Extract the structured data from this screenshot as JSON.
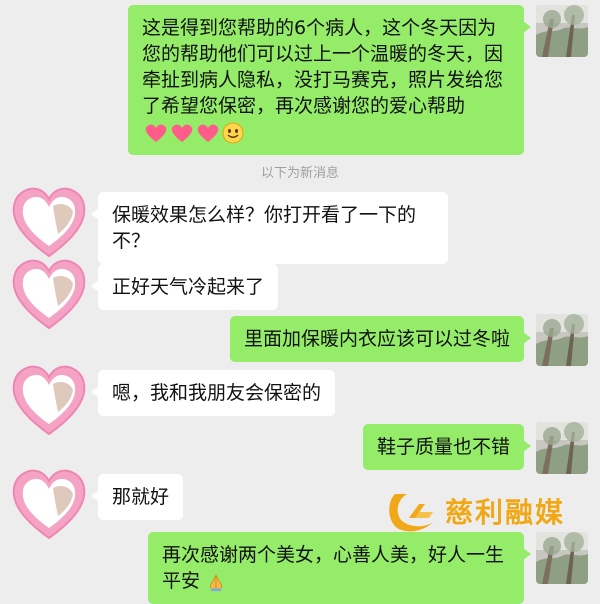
{
  "divider_text": "以下为新消息",
  "messages": [
    {
      "side": "right",
      "text": "这是得到您帮助的6个病人，这个冬天因为您的帮助他们可以过上一个温暖的冬天，因牵扯到病人隐私，没打马赛克，照片发给您了希望您保密，再次感谢您的爱心帮助",
      "emoji": [
        "heart-emoji",
        "heart-emoji",
        "heart-emoji",
        "smile-emoji"
      ]
    },
    {
      "side": "left",
      "text": "保暖效果怎么样？你打开看了一下的不？"
    },
    {
      "side": "left",
      "text": "正好天气冷起来了"
    },
    {
      "side": "right",
      "text": "里面加保暖内衣应该可以过冬啦"
    },
    {
      "side": "left",
      "text": "嗯，我和我朋友会保密的"
    },
    {
      "side": "right",
      "text": "鞋子质量也不错"
    },
    {
      "side": "left",
      "text": "那就好"
    },
    {
      "side": "right",
      "text": "再次感谢两个美女，心善人美，好人一生平安",
      "emoji": [
        "pray-emoji"
      ]
    }
  ],
  "watermark": {
    "text": "慈利融媒",
    "icon": "cili-media-logo"
  },
  "colors": {
    "background": "#ededed",
    "bubble_self": "#95ec69",
    "bubble_other": "#ffffff",
    "divider_text": "#a0a0a0",
    "watermark": "#f0a818"
  }
}
